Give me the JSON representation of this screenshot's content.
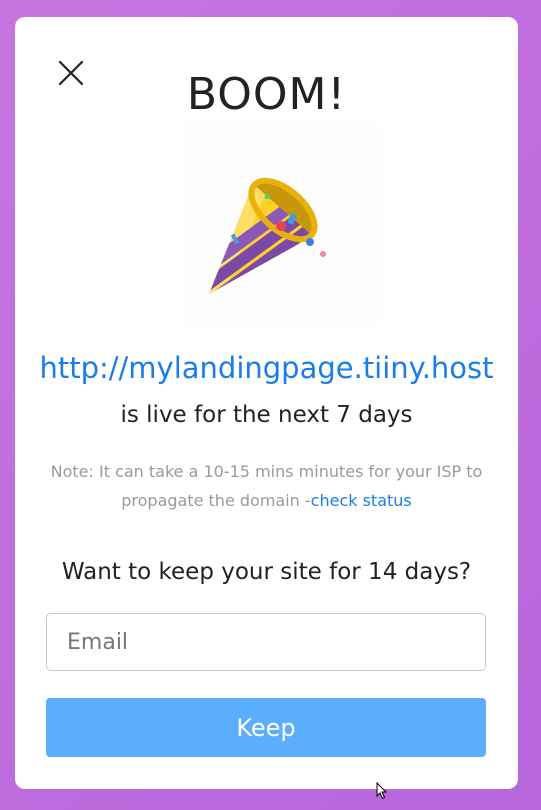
{
  "modal": {
    "title": "BOOM!",
    "url": "http://mylandingpage.tiiny.host",
    "live_text": "is live for the next 7 days",
    "note_text": "Note: It can take a 10-15 mins minutes for your ISP to propagate the domain -",
    "check_status_label": "check status",
    "keep_question": "Want to keep your site for 14 days?",
    "email_placeholder": "Email",
    "keep_label": "Keep"
  },
  "icons": {
    "close": "close-icon",
    "party": "party-popper-icon",
    "cursor": "mouse-cursor-icon"
  },
  "colors": {
    "background": "#c675e0",
    "link": "#1a7ee6",
    "button": "#5aaefb"
  }
}
